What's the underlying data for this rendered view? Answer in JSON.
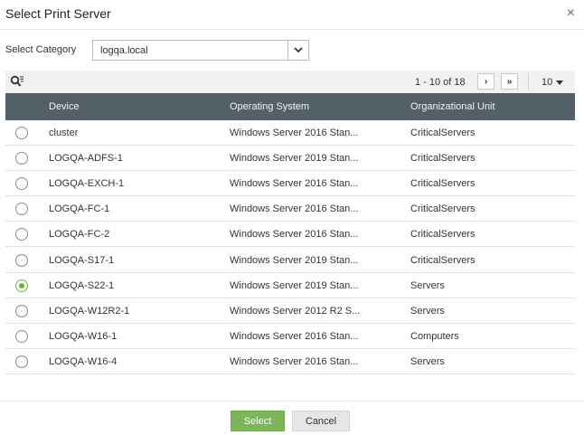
{
  "dialog": {
    "title": "Select Print Server",
    "close_glyph": "×"
  },
  "category": {
    "label": "Select Category",
    "value": "logqa.local"
  },
  "pager": {
    "range_text": "1 - 10 of 18",
    "per_page": "10",
    "next_glyph": "›",
    "last_glyph": "»"
  },
  "table": {
    "columns": [
      "Device",
      "Operating System",
      "Organizational Unit"
    ],
    "rows": [
      {
        "device": "cluster",
        "os": "Windows Server 2016 Stan...",
        "ou": "CriticalServers",
        "selected": false
      },
      {
        "device": "LOGQA-ADFS-1",
        "os": "Windows Server 2019 Stan...",
        "ou": "CriticalServers",
        "selected": false
      },
      {
        "device": "LOGQA-EXCH-1",
        "os": "Windows Server 2016 Stan...",
        "ou": "CriticalServers",
        "selected": false
      },
      {
        "device": "LOGQA-FC-1",
        "os": "Windows Server 2016 Stan...",
        "ou": "CriticalServers",
        "selected": false
      },
      {
        "device": "LOGQA-FC-2",
        "os": "Windows Server 2016 Stan...",
        "ou": "CriticalServers",
        "selected": false
      },
      {
        "device": "LOGQA-S17-1",
        "os": "Windows Server 2019 Stan...",
        "ou": "CriticalServers",
        "selected": false
      },
      {
        "device": "LOGQA-S22-1",
        "os": "Windows Server 2019 Stan...",
        "ou": "Servers",
        "selected": true
      },
      {
        "device": "LOGQA-W12R2-1",
        "os": "Windows Server 2012 R2 S...",
        "ou": "Servers",
        "selected": false
      },
      {
        "device": "LOGQA-W16-1",
        "os": "Windows Server 2016 Stan...",
        "ou": "Computers",
        "selected": false
      },
      {
        "device": "LOGQA-W16-4",
        "os": "Windows Server 2016 Stan...",
        "ou": "Servers",
        "selected": false
      }
    ]
  },
  "buttons": {
    "select_label": "Select",
    "cancel_label": "Cancel"
  },
  "colors": {
    "header_bg": "#546068",
    "accent_green": "#7cb55a",
    "radio_checked": "#6db33f"
  },
  "icons": {
    "search": "search-filter-icon",
    "dropdown": "chevron-down-icon",
    "close": "close-icon"
  }
}
